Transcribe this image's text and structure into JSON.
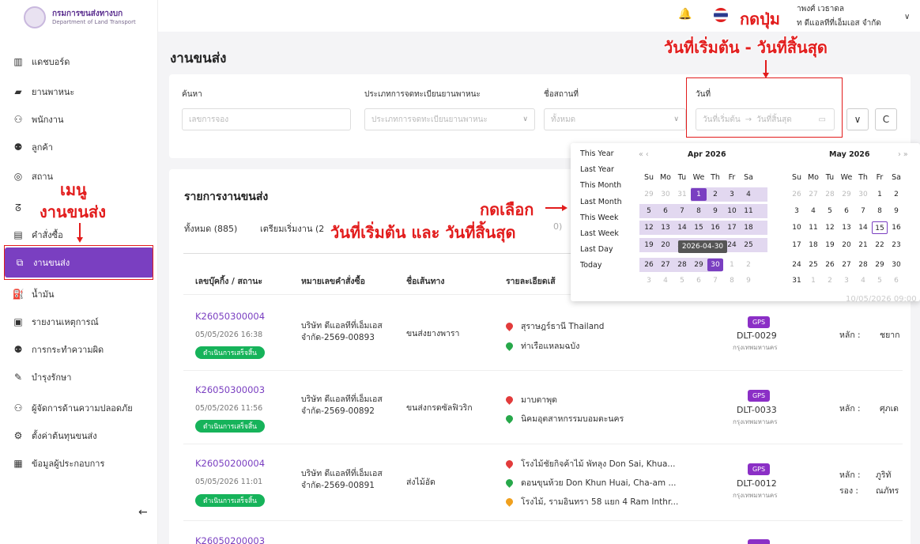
{
  "brand": {
    "name_th": "กรมการขนส่งทางบก",
    "name_en": "Department of Land Transport"
  },
  "sidebar": {
    "items": [
      {
        "label": "แดชบอร์ด",
        "icon": "chart-bar-icon"
      },
      {
        "label": "ยานพาหนะ",
        "icon": "truck-icon"
      },
      {
        "label": "พนักงาน",
        "icon": "person-icon"
      },
      {
        "label": "ลูกค้า",
        "icon": "people-icon"
      },
      {
        "label": "สถาน",
        "icon": "location-pin-icon"
      },
      {
        "label": "",
        "icon": "route-icon"
      },
      {
        "label": "คำสั่งซื้อ",
        "icon": "clipboard-icon"
      },
      {
        "label": "งานขนส่ง",
        "icon": "shipment-icon"
      },
      {
        "label": "น้ำมัน",
        "icon": "fuel-icon"
      },
      {
        "label": "รายงานเหตุการณ์",
        "icon": "report-icon"
      },
      {
        "label": "การกระทำความผิด",
        "icon": "violation-icon"
      },
      {
        "label": "บำรุงรักษา",
        "icon": "wrench-icon"
      },
      {
        "label": "ผู้จัดการด้านความปลอดภัย",
        "icon": "safety-manager-icon"
      },
      {
        "label": "ตั้งค่าต้นทุนขนส่ง",
        "icon": "gear-icon"
      },
      {
        "label": "ข้อมูลผู้ประกอบการ",
        "icon": "building-icon"
      }
    ],
    "active_index": 7
  },
  "user": {
    "name": "าพงศ์ เวธาดล",
    "company": "ท ดีแอลทีที่เอ็มเอส จำกัด"
  },
  "page": {
    "title": "งานขนส่ง"
  },
  "filters": {
    "search": {
      "label": "ค้นหา",
      "placeholder": "เลขการจอง"
    },
    "reg_type": {
      "label": "ประเภทการจดทะเบียนยานพาหนะ",
      "placeholder": "ประเภทการจดทะเบียนยานพาหนะ"
    },
    "place": {
      "label": "ชื่อสถานที่",
      "placeholder": "ทั้งหมด"
    },
    "date": {
      "label": "วันที่",
      "start_placeholder": "วันที่เริ่มต้น",
      "end_placeholder": "วันที่สิ้นสุด",
      "arrow": "→"
    }
  },
  "list": {
    "title": "รายการงานขนส่ง",
    "tabs": [
      "ทั้งหมด (885)",
      "เตรียมเริ่มงาน (2",
      "0)"
    ],
    "columns": [
      "เลขบุ๊คกิ้ง / สถานะ",
      "หมายเลขคำสั่งซื้อ",
      "ชื่อเส้นทาง",
      "รายละเอียดเส้"
    ],
    "driver_main_label": "หลัก :",
    "driver_sub_label": "รอง :",
    "rows": [
      {
        "booking": "K26050300004",
        "date": "05/05/2026 16:38",
        "status": "ดำเนินการเสร็จสิ้น",
        "order_line1": "บริษัท ดีแอลทีที่เอ็มเอส",
        "order_line2": "จำกัด-2569-00893",
        "route": "ขนส่งยางพารา",
        "stops": [
          "สุราษฎร์ธานี Thailand",
          "ท่าเรือแหลมฉบัง"
        ],
        "gps": "GPS",
        "plate": "DLT-0029",
        "province": "กรุงเทพมหานคร",
        "driver_main": "ชยาก",
        "driver_sub": ""
      },
      {
        "booking": "K26050300003",
        "date": "05/05/2026 11:56",
        "status": "ดำเนินการเสร็จสิ้น",
        "order_line1": "บริษัท ดีแอลทีที่เอ็มเอส",
        "order_line2": "จำกัด-2569-00892",
        "route": "ขนส่งกรดซัลฟิวริก",
        "stops": [
          "มาบตาพุด",
          "นิคมอุตสาหกรรมบอมตะนคร"
        ],
        "gps": "GPS",
        "plate": "DLT-0033",
        "province": "กรุงเทพมหานคร",
        "driver_main": "ศุภเด",
        "driver_sub": ""
      },
      {
        "booking": "K26050200004",
        "date": "05/05/2026 11:01",
        "status": "ดำเนินการเสร็จสิ้น",
        "order_line1": "บริษัท ดีแอลทีที่เอ็มเอส",
        "order_line2": "จำกัด-2569-00891",
        "route": "ส่งไม้อัด",
        "stops": [
          "โรงไม้ชัยกิจค้าไม้ พัทลุง Don Sai, Khua...",
          "ดอนขุนห้วย Don Khun Huai, Cha-am ...",
          "โรงไม้, รามอินทรา 58 แยก 4 Ram Inthr..."
        ],
        "gps": "GPS",
        "plate": "DLT-0012",
        "province": "กรุงเทพมหานคร",
        "driver_main": "ภูริทั",
        "driver_sub": "ณภัทร"
      },
      {
        "booking": "K26050200003"
      }
    ],
    "hidden_date_fragment": "10/05/2026 09:00"
  },
  "datepicker": {
    "presets": [
      "This Year",
      "Last Year",
      "This Month",
      "Last Month",
      "This Week",
      "Last Week",
      "Last Day",
      "Today"
    ],
    "weekdays": [
      "Su",
      "Mo",
      "Tu",
      "We",
      "Th",
      "Fr",
      "Sa"
    ],
    "nav_prev": "« ‹",
    "nav_next": "› »",
    "left_month": "Apr 2026",
    "right_month": "May 2026",
    "tooltip": "2026-04-30",
    "left_days": [
      "29",
      "30",
      "31",
      "1",
      "2",
      "3",
      "4",
      "5",
      "6",
      "7",
      "8",
      "9",
      "10",
      "11",
      "12",
      "13",
      "14",
      "15",
      "16",
      "17",
      "18",
      "19",
      "20",
      "21",
      "22",
      "23",
      "24",
      "25",
      "26",
      "27",
      "28",
      "29",
      "30",
      "1",
      "2",
      "3",
      "4",
      "5",
      "6",
      "7",
      "8",
      "9"
    ],
    "right_days": [
      "26",
      "27",
      "28",
      "29",
      "30",
      "1",
      "2",
      "3",
      "4",
      "5",
      "6",
      "7",
      "8",
      "9",
      "10",
      "11",
      "12",
      "13",
      "14",
      "15",
      "16",
      "17",
      "18",
      "19",
      "20",
      "21",
      "22",
      "23",
      "24",
      "25",
      "26",
      "27",
      "28",
      "29",
      "30",
      "31",
      "1",
      "2",
      "3",
      "4",
      "5",
      "6"
    ]
  },
  "annotations": {
    "top_line1": "กดปุ่ม",
    "top_line2": "วันที่เริ่มต้น - วันที่สิ้นสุด",
    "menu_line1": "เมนู",
    "menu_line2": "งานขนส่ง",
    "pick_line1": "กดเลือก",
    "pick_line2": "วันที่เริ่มต้น และ วันที่สิ้นสุด",
    "color": "#e21c1c"
  },
  "colors": {
    "accent": "#7a3fc1",
    "status_done": "#16b35a",
    "gps_badge": "#8b2fc6"
  }
}
